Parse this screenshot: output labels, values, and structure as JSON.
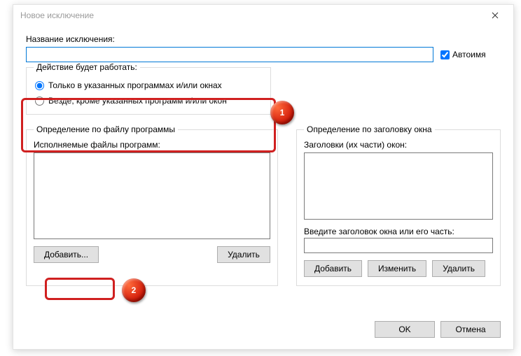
{
  "window": {
    "title": "Новое исключение"
  },
  "name_section": {
    "label": "Название исключения:",
    "value": "",
    "auto_name": "Автоимя",
    "auto_name_checked": true
  },
  "action_group": {
    "legend": "Действие будет работать:",
    "opt_only": "Только в указанных программах и/или окнах",
    "opt_except": "Везде, кроме указанных программ и/или окон",
    "selected": "only"
  },
  "file_group": {
    "legend": "Определение по файлу программы",
    "list_label": "Исполняемые файлы программ:",
    "add": "Добавить...",
    "delete": "Удалить"
  },
  "title_group": {
    "legend": "Определение по заголовку окна",
    "list_label": "Заголовки (их части) окон:",
    "input_label": "Введите заголовок окна или его часть:",
    "input_value": "",
    "add": "Добавить",
    "edit": "Изменить",
    "delete": "Удалить"
  },
  "footer": {
    "ok": "OK",
    "cancel": "Отмена"
  },
  "markers": {
    "one": "1",
    "two": "2"
  }
}
